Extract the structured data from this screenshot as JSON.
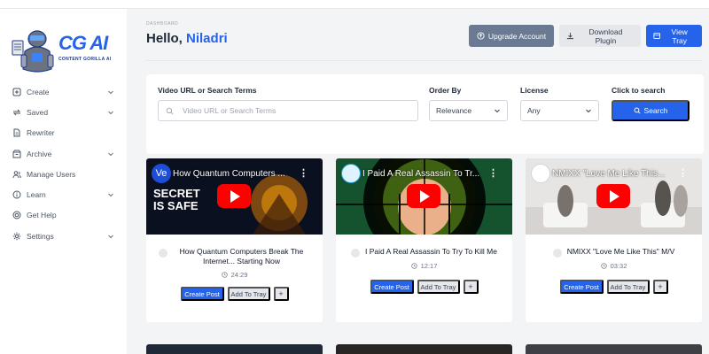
{
  "logo": {
    "brand": "CG",
    "brand_ai": "AI",
    "subtitle": "CONTENT GORILLA AI"
  },
  "sidebar": {
    "items": [
      {
        "label": "Create",
        "icon": "plus-square-icon",
        "expandable": true
      },
      {
        "label": "Saved",
        "icon": "repeat-icon",
        "expandable": true
      },
      {
        "label": "Rewriter",
        "icon": "document-icon",
        "expandable": false
      },
      {
        "label": "Archive",
        "icon": "archive-icon",
        "expandable": true
      },
      {
        "label": "Manage Users",
        "icon": "users-icon",
        "expandable": false
      },
      {
        "label": "Learn",
        "icon": "info-icon",
        "expandable": true
      },
      {
        "label": "Get Help",
        "icon": "help-icon",
        "expandable": false
      },
      {
        "label": "Settings",
        "icon": "gear-icon",
        "expandable": true
      }
    ]
  },
  "header": {
    "breadcrumb": "DASHBOARD",
    "greeting": "Hello,",
    "user_name": "Niladri",
    "upgrade_label": "Upgrade Account",
    "download_label": "Download Plugin",
    "view_tray_label": "View Tray"
  },
  "search": {
    "url_label": "Video URL or Search Terms",
    "url_placeholder": "Video URL or Search Terms",
    "order_label": "Order By",
    "order_value": "Relevance",
    "license_label": "License",
    "license_value": "Any",
    "click_label": "Click to search",
    "search_button": "Search"
  },
  "videos": [
    {
      "thumb_title": "How Quantum Computers ...",
      "title": "How Quantum Computers Break The Internet... Starting Now",
      "duration": "24:29",
      "overlay_1": "SECRET",
      "overlay_2": "IS SAFE",
      "channel": "Ve"
    },
    {
      "thumb_title": "I Paid A Real Assassin To Tr...",
      "title": "I Paid A Real Assassin To Try To Kill Me",
      "duration": "12:17"
    },
    {
      "thumb_title": "NMIXX \"Love Me Like This...",
      "title": "NMIXX \"Love Me Like This\" M/V",
      "duration": "03:32"
    }
  ],
  "card_actions": {
    "create_label": "Create Post",
    "tray_label": "Add To Tray",
    "plus_label": "+"
  },
  "colors": {
    "accent": "#2563eb",
    "youtube_red": "#ff0000",
    "upgrade_gray": "#6b7a93"
  }
}
